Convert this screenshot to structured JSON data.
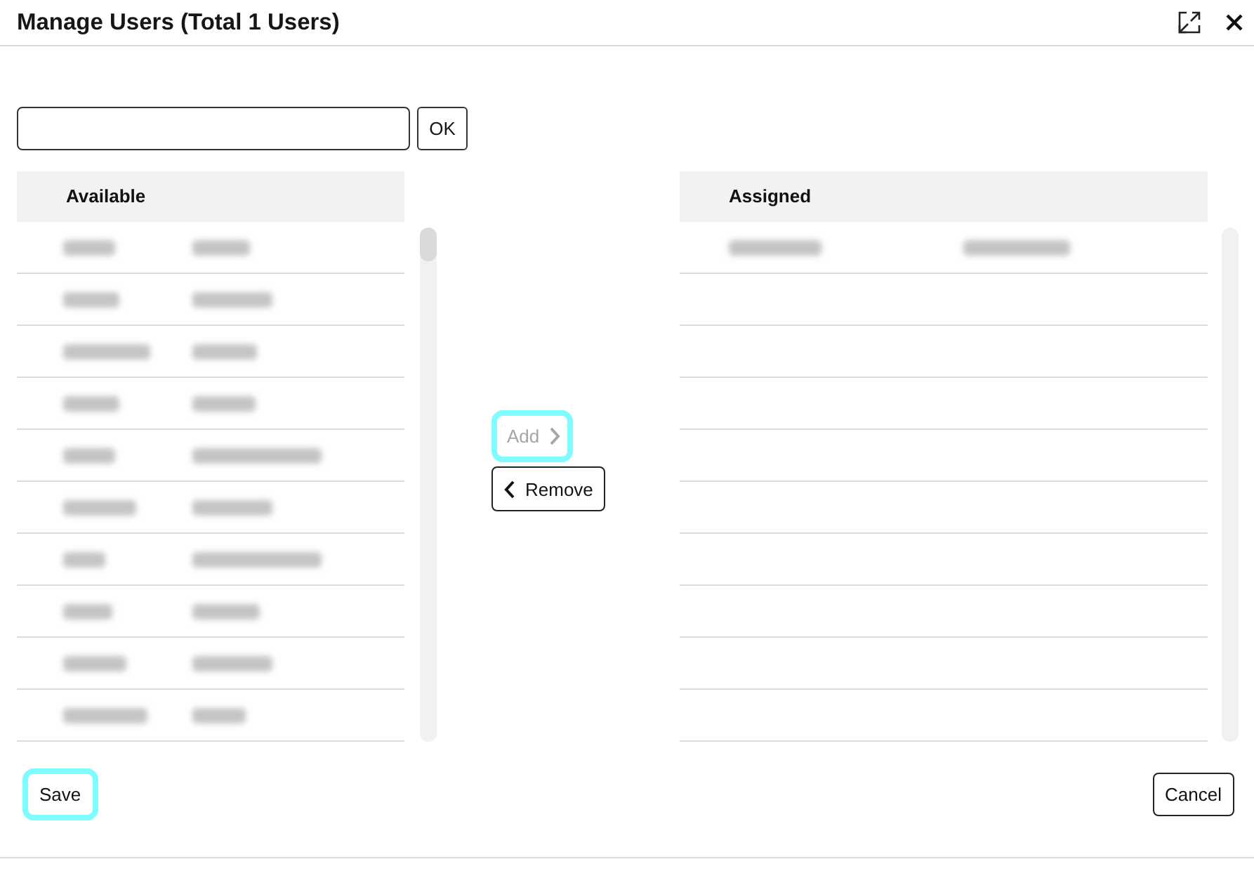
{
  "window": {
    "title": "Manage Users (Total 1 Users)",
    "buttons": [
      {
        "kind": "maximize"
      },
      {
        "kind": "close"
      }
    ]
  },
  "search": {
    "button": "OK"
  },
  "available": {
    "heading": "Available",
    "rows": [
      {
        "kind": "blurred"
      },
      {
        "kind": "blurred"
      },
      {
        "kind": "blurred"
      },
      {
        "kind": "blurred"
      },
      {
        "kind": "blurred"
      },
      {
        "kind": "blurred"
      },
      {
        "kind": "blurred"
      },
      {
        "kind": "blurred"
      },
      {
        "kind": "blurred"
      },
      {
        "kind": "blurred"
      }
    ]
  },
  "transfer_buttons": [
    {
      "kind": "add",
      "label": "Add",
      "disabled": true,
      "focused": true
    },
    {
      "kind": "remove",
      "label": "Remove",
      "disabled": false,
      "focused": false
    }
  ],
  "assigned": {
    "heading": "Assigned",
    "rows": [
      {
        "kind": "blurred"
      }
    ]
  },
  "footer": {
    "buttons": [
      {
        "label": "Save",
        "focused": true
      },
      {
        "label": "Cancel",
        "focused": false
      }
    ]
  }
}
